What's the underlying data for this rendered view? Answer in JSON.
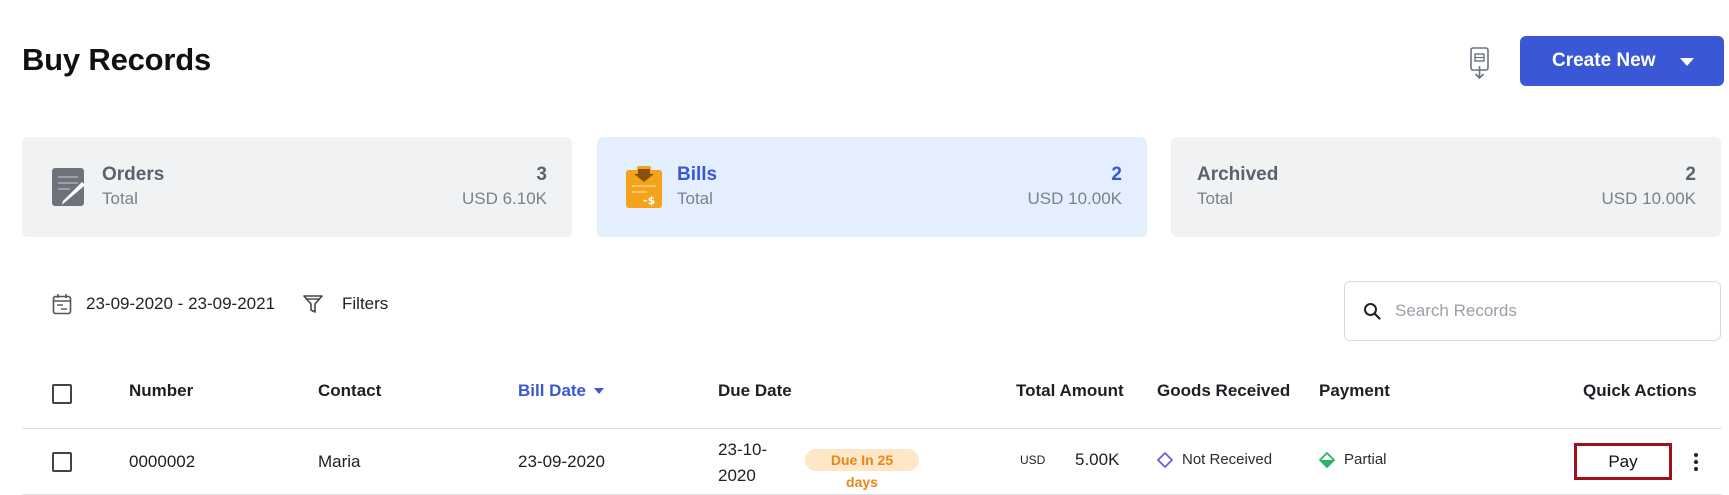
{
  "header": {
    "title": "Buy Records",
    "create_label": "Create New"
  },
  "cards": [
    {
      "label": "Orders",
      "sub": "Total",
      "count": "3",
      "amount": "USD 6.10K"
    },
    {
      "label": "Bills",
      "sub": "Total",
      "count": "2",
      "amount": "USD 10.00K"
    },
    {
      "label": "Archived",
      "sub": "Total",
      "count": "2",
      "amount": "USD 10.00K"
    }
  ],
  "toolbar": {
    "date_range": "23-09-2020 - 23-09-2021",
    "filters_label": "Filters",
    "search_placeholder": "Search Records"
  },
  "table": {
    "columns": {
      "number": "Number",
      "contact": "Contact",
      "bill_date": "Bill Date",
      "due_date": "Due Date",
      "total_amount": "Total Amount",
      "goods_received": "Goods Received",
      "payment": "Payment",
      "quick_actions": "Quick Actions"
    },
    "rows": [
      {
        "number": "0000002",
        "contact": "Maria",
        "bill_date": "23-09-2020",
        "due_date_line1": "23-10-",
        "due_date_line2": "2020",
        "due_badge_line1": "Due In 25",
        "due_badge_line2": "days",
        "currency": "USD",
        "amount": "5.00K",
        "goods_received": "Not Received",
        "payment": "Partial",
        "action_label": "Pay"
      }
    ]
  },
  "colors": {
    "accent": "#3a57d6",
    "active_card_bg": "#e3efff",
    "badge_bg": "#fde7c6",
    "badge_text": "#e8861a",
    "not_received": "#6b5fd6",
    "partial": "#28b463",
    "pay_border": "#a0101a"
  }
}
